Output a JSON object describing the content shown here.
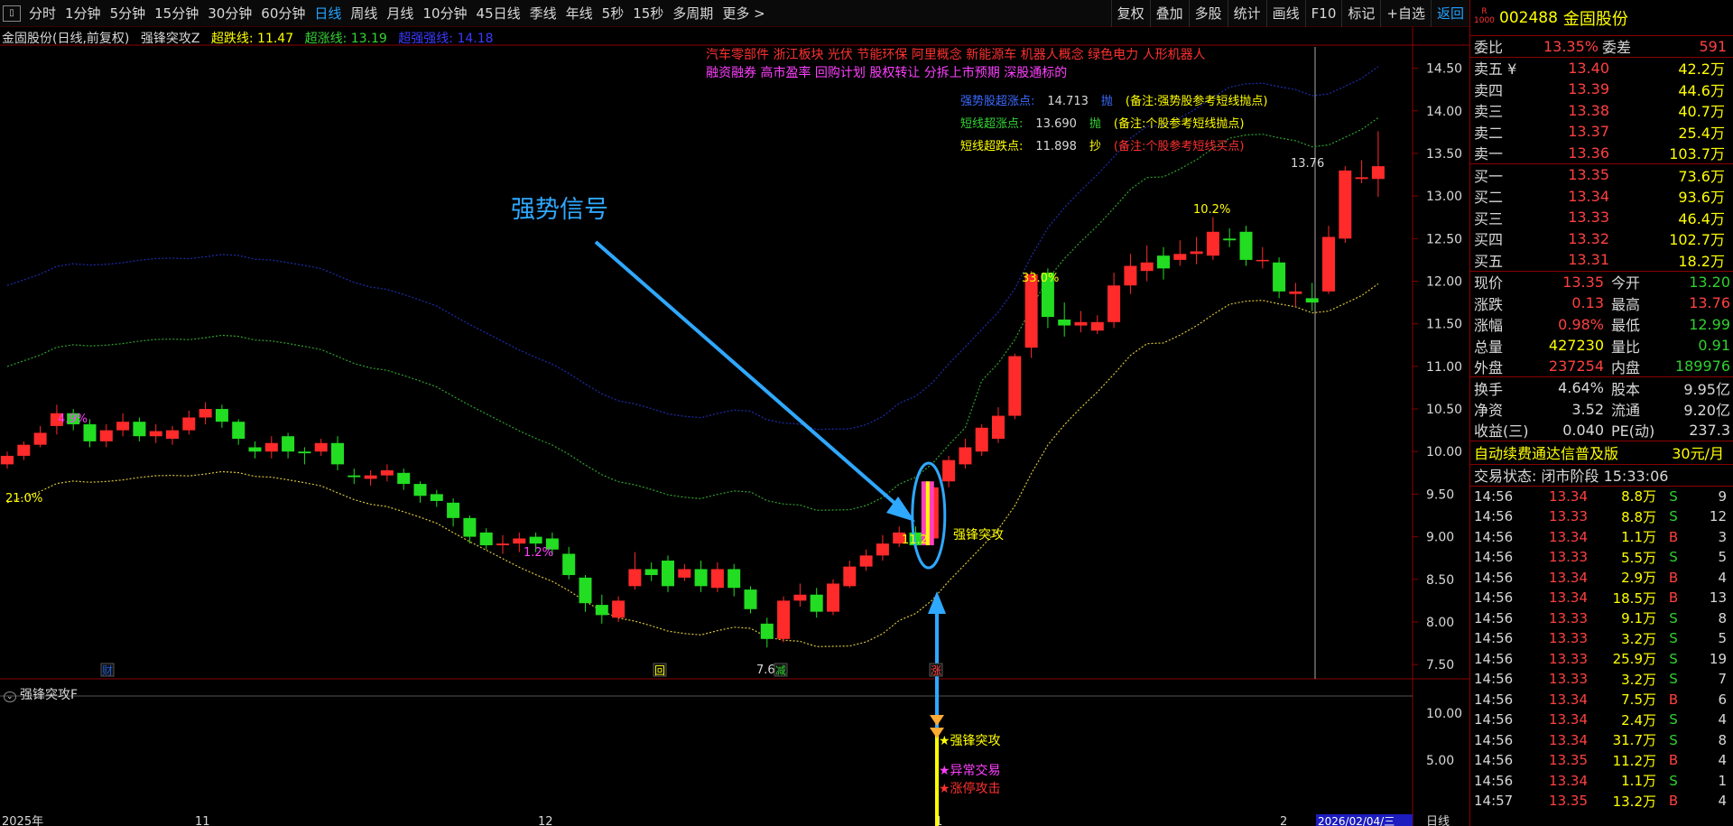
{
  "toolbar": {
    "menu_icon": "panel-toggle-icon",
    "tabs": [
      "分时",
      "1分钟",
      "5分钟",
      "15分钟",
      "30分钟",
      "60分钟",
      "日线",
      "周线",
      "月线",
      "10分钟",
      "45日线",
      "季线",
      "年线",
      "5秒",
      "15秒",
      "多周期",
      "更多 >"
    ],
    "active_tab": "日线",
    "right_tools": [
      "复权",
      "叠加",
      "多股",
      "统计",
      "画线",
      "F10",
      "标记",
      "+自选",
      "返回"
    ]
  },
  "chart_header": {
    "symbol": "金固股份(日线,前复权)",
    "indicator": "强锋突攻Z",
    "line1": "超跌线: 11.47",
    "line2": "超涨线: 13.19",
    "line3": "超强强线: 14.18"
  },
  "concepts": {
    "line1": "汽车零部件 浙江板块   光伏 节能环保 阿里概念 新能源车 机器人概念 绿色电力 人形机器人",
    "line2": "融资融券 高市盈率 回购计划 股权转让 分拆上市预期 深股通标的"
  },
  "signal_table": [
    {
      "label": "强势股超涨点:",
      "value": "14.713",
      "action": "抛",
      "note": "(备注:强势股参考短线抛点)",
      "color": "#3a6bff"
    },
    {
      "label": "短线超涨点:",
      "value": "13.690",
      "action": "抛",
      "note": "(备注:个股参考短线抛点)",
      "color": "#34d334"
    },
    {
      "label": "短线超跌点:",
      "value": "11.898",
      "action": "抄",
      "note": "(备注:个股参考短线买点)",
      "color": "#ffff00"
    }
  ],
  "annotation": {
    "strong_signal": "强势信号",
    "breakout_label": "强锋突攻",
    "pct_labels": [
      "4.9%",
      "21.0%",
      "1.2%",
      "33.0%",
      "10.2%"
    ],
    "price_marks": [
      "7.69",
      "13.76",
      "11.2"
    ],
    "event_markers": [
      "财",
      "回",
      "减",
      "涨"
    ]
  },
  "sub_chart": {
    "title": "强锋突攻F",
    "labels": [
      "强锋突攻",
      "异常交易",
      "涨停攻击"
    ],
    "y_ticks": [
      "10.00",
      "5.00"
    ]
  },
  "axes": {
    "price_ticks": [
      "14.50",
      "14.00",
      "13.50",
      "13.00",
      "12.50",
      "12.00",
      "11.50",
      "11.00",
      "10.50",
      "10.00",
      "9.50",
      "9.00",
      "8.50",
      "8.00",
      "7.50"
    ],
    "date_labels": [
      "2025年",
      "11",
      "12",
      "1",
      "2"
    ],
    "cursor_date": "2026/02/04/三",
    "axis_mode": "日线"
  },
  "chart_data": {
    "type": "candlestick",
    "y_range": [
      7.3,
      14.75
    ],
    "candles": [
      [
        9.85,
        9.95,
        9.8,
        10.0
      ],
      [
        9.95,
        10.08,
        9.9,
        10.12
      ],
      [
        10.08,
        10.22,
        10.05,
        10.3
      ],
      [
        10.3,
        10.45,
        10.2,
        10.55
      ],
      [
        10.45,
        10.32,
        10.25,
        10.5
      ],
      [
        10.32,
        10.12,
        10.05,
        10.38
      ],
      [
        10.12,
        10.25,
        10.05,
        10.32
      ],
      [
        10.25,
        10.35,
        10.18,
        10.45
      ],
      [
        10.35,
        10.18,
        10.12,
        10.4
      ],
      [
        10.18,
        10.24,
        10.1,
        10.32
      ],
      [
        10.15,
        10.25,
        10.08,
        10.3
      ],
      [
        10.25,
        10.4,
        10.2,
        10.48
      ],
      [
        10.4,
        10.5,
        10.32,
        10.58
      ],
      [
        10.5,
        10.35,
        10.28,
        10.55
      ],
      [
        10.35,
        10.15,
        10.08,
        10.38
      ],
      [
        10.05,
        10.0,
        9.92,
        10.12
      ],
      [
        10.0,
        10.1,
        9.92,
        10.18
      ],
      [
        10.18,
        10.0,
        9.92,
        10.22
      ],
      [
        10.0,
        9.98,
        9.85,
        10.05
      ],
      [
        10.0,
        10.1,
        9.95,
        10.15
      ],
      [
        10.1,
        9.85,
        9.78,
        10.18
      ],
      [
        9.72,
        9.7,
        9.62,
        9.8
      ],
      [
        9.68,
        9.72,
        9.6,
        9.78
      ],
      [
        9.72,
        9.78,
        9.65,
        9.85
      ],
      [
        9.75,
        9.62,
        9.55,
        9.8
      ],
      [
        9.62,
        9.48,
        9.4,
        9.65
      ],
      [
        9.5,
        9.42,
        9.35,
        9.55
      ],
      [
        9.4,
        9.22,
        9.12,
        9.45
      ],
      [
        9.22,
        9.0,
        8.92,
        9.25
      ],
      [
        9.05,
        8.9,
        8.85,
        9.1
      ],
      [
        8.9,
        8.92,
        8.8,
        9.02
      ],
      [
        8.92,
        8.98,
        8.82,
        9.05
      ],
      [
        9.0,
        8.92,
        8.82,
        9.05
      ],
      [
        8.98,
        8.85,
        8.78,
        9.05
      ],
      [
        8.8,
        8.55,
        8.5,
        8.88
      ],
      [
        8.52,
        8.22,
        8.12,
        8.55
      ],
      [
        8.2,
        8.08,
        7.98,
        8.32
      ],
      [
        8.05,
        8.25,
        8.0,
        8.3
      ],
      [
        8.42,
        8.62,
        8.38,
        8.82
      ],
      [
        8.62,
        8.55,
        8.48,
        8.7
      ],
      [
        8.72,
        8.42,
        8.35,
        8.78
      ],
      [
        8.52,
        8.62,
        8.48,
        8.68
      ],
      [
        8.62,
        8.42,
        8.35,
        8.72
      ],
      [
        8.4,
        8.62,
        8.35,
        8.7
      ],
      [
        8.62,
        8.4,
        8.3,
        8.68
      ],
      [
        8.38,
        8.15,
        8.1,
        8.42
      ],
      [
        7.98,
        7.8,
        7.7,
        8.05
      ],
      [
        7.8,
        8.25,
        7.76,
        8.3
      ],
      [
        8.25,
        8.32,
        8.18,
        8.45
      ],
      [
        8.32,
        8.12,
        8.05,
        8.4
      ],
      [
        8.12,
        8.45,
        8.08,
        8.5
      ],
      [
        8.42,
        8.65,
        8.4,
        8.72
      ],
      [
        8.65,
        8.78,
        8.6,
        8.85
      ],
      [
        8.78,
        8.92,
        8.72,
        9.02
      ],
      [
        8.92,
        9.05,
        8.88,
        9.12
      ],
      [
        9.05,
        8.9,
        8.85,
        9.12
      ],
      [
        8.98,
        9.58,
        8.92,
        9.65
      ],
      [
        9.65,
        9.9,
        9.58,
        9.95
      ],
      [
        9.85,
        10.05,
        9.8,
        10.15
      ],
      [
        10.0,
        10.28,
        9.95,
        10.32
      ],
      [
        10.15,
        10.42,
        10.1,
        10.52
      ],
      [
        10.42,
        11.12,
        10.38,
        11.15
      ],
      [
        11.22,
        12.08,
        11.1,
        12.12
      ],
      [
        12.1,
        11.58,
        11.45,
        12.15
      ],
      [
        11.55,
        11.48,
        11.35,
        11.75
      ],
      [
        11.48,
        11.52,
        11.4,
        11.65
      ],
      [
        11.42,
        11.52,
        11.38,
        11.6
      ],
      [
        11.52,
        11.95,
        11.45,
        12.1
      ],
      [
        11.95,
        12.18,
        11.85,
        12.32
      ],
      [
        12.12,
        12.22,
        12.0,
        12.42
      ],
      [
        12.3,
        12.15,
        12.02,
        12.4
      ],
      [
        12.25,
        12.32,
        12.18,
        12.48
      ],
      [
        12.32,
        12.35,
        12.2,
        12.52
      ],
      [
        12.3,
        12.58,
        12.25,
        12.75
      ],
      [
        12.5,
        12.48,
        12.4,
        12.62
      ],
      [
        12.58,
        12.25,
        12.18,
        12.65
      ],
      [
        12.25,
        12.25,
        12.15,
        12.4
      ],
      [
        12.22,
        11.88,
        11.8,
        12.28
      ],
      [
        11.85,
        11.88,
        11.7,
        11.98
      ],
      [
        11.8,
        11.75,
        11.65,
        11.98
      ],
      [
        11.88,
        12.52,
        11.85,
        12.65
      ],
      [
        12.5,
        13.3,
        12.45,
        13.35
      ],
      [
        13.2,
        13.22,
        13.15,
        13.42
      ],
      [
        13.2,
        13.35,
        12.99,
        13.76
      ]
    ]
  }
}
